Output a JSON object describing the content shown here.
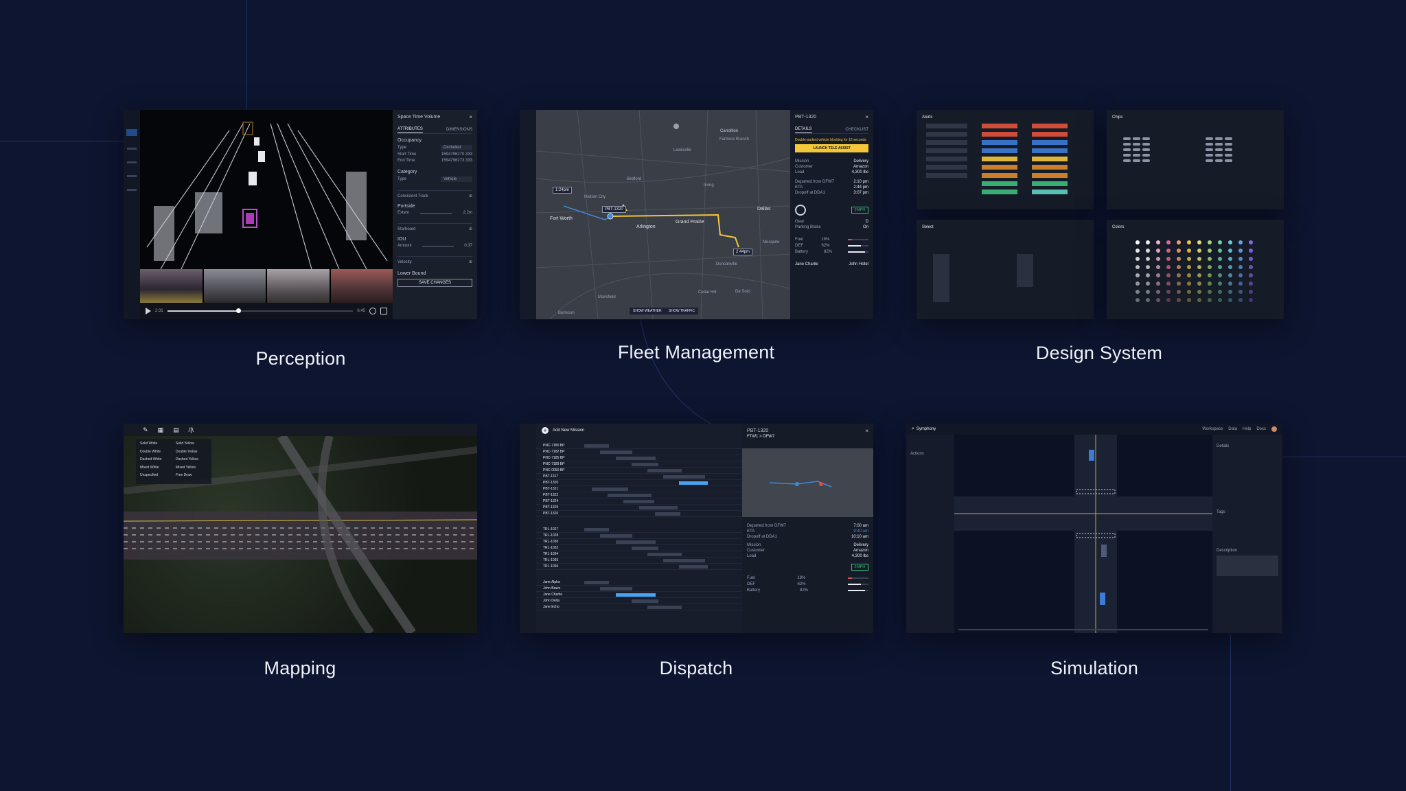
{
  "captions": {
    "perception": "Perception",
    "fleet": "Fleet Management",
    "design": "Design System",
    "mapping": "Mapping",
    "dispatch": "Dispatch",
    "simulation": "Simulation"
  },
  "perception": {
    "panel_title": "Space Time Volume",
    "tab_attributes": "ATTRIBUTES",
    "tab_dimensions": "DIMENSIONS",
    "occupancy": "Occupancy",
    "type_label": "Type",
    "type_value": "Occluded",
    "start_time_label": "Start Time",
    "start_time": "1594796270.333",
    "end_time_label": "End Time",
    "end_time": "1594796273.333",
    "category": "Category",
    "category_value": "Vehicle",
    "consistent_track": "Consistent Track",
    "portside": "Portside",
    "extent_label": "Extent",
    "extent_value": "2.2m",
    "starboard": "Starboard",
    "iou": "IOU",
    "amount_label": "Amount",
    "amount_value": "0.37",
    "velocity": "Velocity",
    "lower_bound": "Lower Bound",
    "save_changes": "SAVE CHANGES",
    "time_start": "2:31",
    "time_end": "6:45",
    "playhead": 0.38
  },
  "fleet": {
    "title": "PBT-1320",
    "tab_details": "DETAILS",
    "tab_checklist": "CHECKLIST",
    "alert": "Double-parked vehicle blocking for 12 seconds",
    "launch_button": "LAUNCH TELE ASSIST",
    "map_labels": [
      "Carrollton",
      "Farmers Branch",
      "Fort Worth",
      "Arlington",
      "Grand Prairie",
      "Dallas",
      "Irving",
      "Mesquite",
      "Cedar Hill",
      "De Soto",
      "Burleson",
      "Mansfield",
      "Duncanville",
      "Bedford",
      "Haltom City",
      "Lewisville"
    ],
    "route_badge": "PBT-1320",
    "eta_badge": "2:44pm",
    "dest_badge": "1:24pm",
    "show_weather": "SHOW WEATHER",
    "show_traffic": "SHOW TRAFFIC",
    "rows": [
      {
        "k": "Mission",
        "v": "Delivery"
      },
      {
        "k": "Customer",
        "v": "Amazon"
      },
      {
        "k": "Load",
        "v": "4,300 lbs"
      },
      {
        "k": "Departed from DFW7",
        "v": "2:10 pm"
      },
      {
        "k": "ETA",
        "v": "2:44 pm"
      },
      {
        "k": "Dropoff at DDA1",
        "v": "3:07 pm"
      }
    ],
    "speed": "0 MPH",
    "gear_label": "Gear",
    "gear_value": "D",
    "parking_label": "Parking Brake",
    "parking_value": "On",
    "fuel_label": "Fuel",
    "fuel_value": "19%",
    "def_label": "DEF",
    "def_value": "62%",
    "battery_label": "Battery",
    "battery_value": "82%",
    "fuel_level": 0.19,
    "def_level": 0.62,
    "battery_level": 0.82,
    "driver_1": "Jane Charlie",
    "driver_2": "John Hotel"
  },
  "design": {
    "alerts": "Alerts",
    "chips": "Chips",
    "select": "Select",
    "colors": "Colors"
  },
  "mapping": {
    "lane_types": [
      "Solid White",
      "Double White",
      "Dashed White",
      "Mixed White",
      "Unspecified",
      "Solid Yellow",
      "Double Yellow",
      "Dashed Yellow",
      "Mixed Yellow",
      "Free Draw"
    ]
  },
  "dispatch": {
    "add_mission": "Add New Mission",
    "right_title": "PBT-1320",
    "right_sub": "FTW1 > DFW7",
    "trucks_a": [
      "PNC-7180 BP",
      "PNC-7182 BP",
      "PNC-7185 BP",
      "PNC-7189 BP",
      "PNC-0050 BP",
      "PBT-1317",
      "PBT-1320",
      "PBT-1321",
      "PBT-1322",
      "PBT-1324",
      "PBT-1325",
      "PBT-1326"
    ],
    "trucks_b": [
      "TRL-1027",
      "TRL-1028",
      "TRL-1030",
      "TRL-1032",
      "TRL-1034",
      "TRL-1035",
      "TRL-1036"
    ],
    "drivers": [
      "Jane Alpha",
      "John Bravo",
      "Jane Charlie",
      "John Delta",
      "Jane Echo"
    ],
    "rows": [
      {
        "k": "Departed from DFW7",
        "v": "7:00 am"
      },
      {
        "k": "ETA",
        "v": "9:40 am"
      },
      {
        "k": "Dropoff at DDA1",
        "v": "10:10 am"
      },
      {
        "k": "Mission",
        "v": "Delivery"
      },
      {
        "k": "Customer",
        "v": "Amazon"
      },
      {
        "k": "Load",
        "v": "4,300 lbs"
      }
    ],
    "speed": "0 MPH",
    "fuel_label": "Fuel",
    "fuel_value": "19%",
    "def_label": "DEF",
    "def_value": "62%",
    "battery_label": "Battery",
    "battery_value": "82%",
    "fuel_level": 0.19,
    "def_level": 0.62,
    "battery_level": 0.82
  },
  "simulation": {
    "app_title": "Symphony",
    "nav": [
      "Workspace",
      "Data",
      "Help",
      "Docs"
    ],
    "actions_label": "Actions",
    "details_label": "Details",
    "tags_label": "Tags",
    "description_label": "Description"
  }
}
